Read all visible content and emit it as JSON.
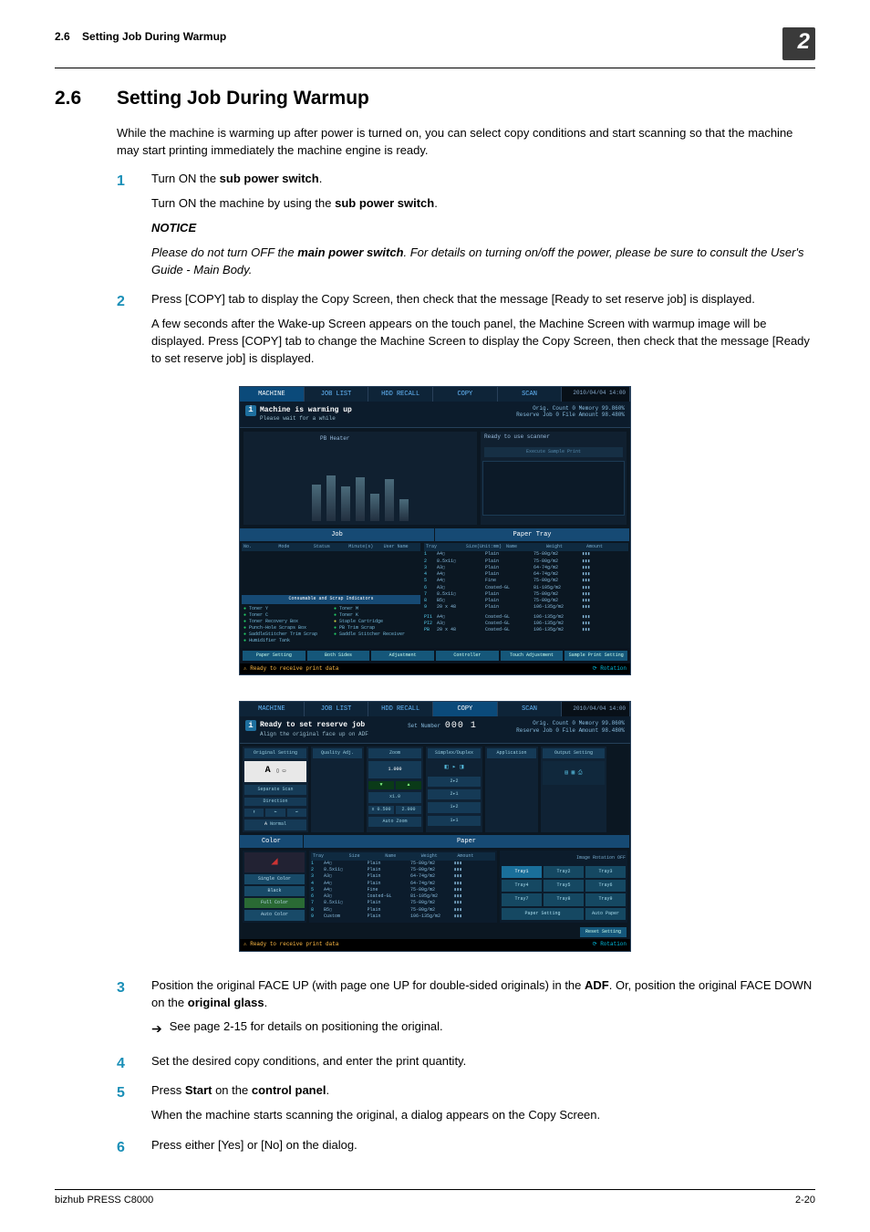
{
  "header": {
    "section_ref": "2.6",
    "section_ref_title": "Setting Job During Warmup",
    "chapter_badge": "2"
  },
  "section": {
    "number": "2.6",
    "title": "Setting Job During Warmup",
    "intro": "While the machine is warming up after power is turned on, you can select copy conditions and start scanning so that the machine may start printing immediately the machine engine is ready."
  },
  "steps": {
    "s1": {
      "num": "1",
      "l1a": "Turn ON the ",
      "l1b": "sub power switch",
      "l1c": ".",
      "l2a": "Turn ON the machine by using the ",
      "l2b": "sub power switch",
      "l2c": ".",
      "notice": "NOTICE",
      "notice_text_a": "Please do not turn OFF the ",
      "notice_text_b": "main power switch",
      "notice_text_c": ". For details on turning on/off the power, please be sure to consult the User's Guide - Main Body."
    },
    "s2": {
      "num": "2",
      "p1": "Press [COPY] tab to display the Copy Screen, then check that the message [Ready to set reserve job] is displayed.",
      "p2": "A few seconds after the Wake-up Screen appears on the touch panel, the Machine Screen with warmup image will be displayed. Press [COPY] tab to change the Machine Screen to display the Copy Screen, then check that the message [Ready to set reserve job] is displayed."
    },
    "s3": {
      "num": "3",
      "p1a": "Position the original FACE UP (with page one UP for double-sided originals) in the ",
      "p1b": "ADF",
      "p1c": ". Or, position the original FACE DOWN on the ",
      "p1d": "original glass",
      "p1e": ".",
      "bullet": "See page 2-15 for details on positioning the original."
    },
    "s4": {
      "num": "4",
      "p1": "Set the desired copy conditions, and enter the print quantity."
    },
    "s5": {
      "num": "5",
      "p1a": "Press ",
      "p1b": "Start",
      "p1c": " on the ",
      "p1d": "control panel",
      "p1e": ".",
      "p2": "When the machine starts scanning the original, a dialog appears on the Copy Screen."
    },
    "s6": {
      "num": "6",
      "p1": "Press either [Yes] or [No] on the dialog."
    }
  },
  "screen1": {
    "tabs": [
      "MACHINE",
      "JOB LIST",
      "HDD RECALL",
      "COPY",
      "SCAN"
    ],
    "datetime": "2010/04/04 14:00",
    "msg_title": "Machine is warming up",
    "msg_sub": "Please wait for a while",
    "counters": {
      "a": "Orig. Count    0   Memory    99.860%",
      "b": "Reserve Job    0   File Amount  98.480%"
    },
    "pb_heater": "PB Heater",
    "ready_scanner": "Ready to use scanner",
    "exec_sample": "Execute Sample Print",
    "job_label": "Job",
    "paper_tray_label": "Paper Tray",
    "job_header": [
      "No.",
      "Mode",
      "Status",
      "Minute(s)",
      "User Name"
    ],
    "paper_header": [
      "Tray",
      "Size(Unit:mm)",
      "Name",
      "Weight",
      "Amount"
    ],
    "trays": [
      [
        "1",
        "A4▢",
        "Plain",
        "75-80g/m2"
      ],
      [
        "2",
        "8.5x11▢",
        "Plain",
        "75-80g/m2"
      ],
      [
        "3",
        "A3▢",
        "Plain",
        "64-74g/m2"
      ],
      [
        "4",
        "A4▢",
        "Plain",
        "64-74g/m2"
      ],
      [
        "5",
        "A4▢",
        "Fine",
        "75-80g/m2"
      ],
      [
        "6",
        "A3▢",
        "Coated-GL",
        "81-105g/m2"
      ],
      [
        "7",
        "8.5x11▢",
        "Plain",
        "75-80g/m2"
      ],
      [
        "8",
        "B5▢",
        "Plain",
        "75-80g/m2"
      ],
      [
        "9",
        "20 x 48",
        "Plain",
        "106-135g/m2"
      ]
    ],
    "pi_trays": [
      [
        "PI1",
        "A4▢",
        "Coated-GL",
        "106-135g/m2"
      ],
      [
        "PI2",
        "A3▢",
        "Coated-GL",
        "106-135g/m2"
      ],
      [
        "PB",
        "20 x 48",
        "Coated-GL",
        "106-135g/m2"
      ]
    ],
    "consum_label": "Consumable and Scrap Indicators",
    "consumables": [
      "Toner Y",
      "Toner M",
      "Toner C",
      "Toner K",
      "Toner Recovery Box",
      "Staple Cartridge",
      "Punch-Hole Scraps Box",
      "PB Trim Scrap",
      "SaddleStitcher Trim Scrap",
      "Saddle Stitcher Receiver",
      "Humidifier Tank"
    ],
    "bottom_buttons": [
      "Paper Setting",
      "Both Sides",
      "Adjustment",
      "Controller",
      "Touch Adjustment",
      "Sample Print Setting"
    ],
    "status": "Ready to receive print data",
    "rotation": "⟳ Rotation"
  },
  "screen2": {
    "tabs": [
      "MACHINE",
      "JOB LIST",
      "HDD RECALL",
      "COPY",
      "SCAN"
    ],
    "datetime": "2010/04/04 14:00",
    "msg_title": "Ready to set reserve job",
    "msg_sub": "Align the original face up on ADF",
    "set_number_label": "Set Number",
    "set_number": "000 1",
    "counters": {
      "a": "Orig. Count    0   Memory    99.860%",
      "b": "Reserve Job    0   File Amount  98.480%"
    },
    "col_headers": [
      "Original Setting",
      "Quality Adj.",
      "Zoom",
      "Simplex/Duplex",
      "Application",
      "Output Setting"
    ],
    "orig_letter": "A",
    "zoom_val": "1.000",
    "zoom_chips": [
      "x1.0",
      "x 0.500",
      "2.000",
      "Auto Zoom"
    ],
    "duplex_chips": [
      "2▸2",
      "2▸1",
      "1▸2",
      "1▸1"
    ],
    "separate_scan": "Separate Scan",
    "direction": "Direction",
    "normal": "Normal",
    "color_label": "Color",
    "color_buttons": [
      "Single Color",
      "Black",
      "Full Color",
      "Auto Color"
    ],
    "paper_label": "Paper",
    "paper_header": [
      "Tray",
      "Size",
      "Name",
      "Weight",
      "Amount"
    ],
    "paper_rows": [
      [
        "1",
        "A4▢",
        "Plain",
        "75-80g/m2"
      ],
      [
        "2",
        "8.5x11▢",
        "Plain",
        "75-80g/m2"
      ],
      [
        "3",
        "A3▢",
        "Plain",
        "64-74g/m2"
      ],
      [
        "4",
        "A4▢",
        "Plain",
        "64-74g/m2"
      ],
      [
        "5",
        "A4▢",
        "Fine",
        "75-80g/m2"
      ],
      [
        "6",
        "A3▢",
        "Coated-GL",
        "81-105g/m2"
      ],
      [
        "7",
        "8.5x11▢",
        "Plain",
        "75-80g/m2"
      ],
      [
        "8",
        "B5▢",
        "Plain",
        "75-80g/m2"
      ],
      [
        "9",
        "Custom",
        "Plain",
        "106-135g/m2"
      ]
    ],
    "image_rotation": "Image Rotation OFF",
    "tray_buttons": [
      "Tray1",
      "Tray2",
      "Tray3",
      "Tray4",
      "Tray5",
      "Tray6",
      "Tray7",
      "Tray8",
      "Tray9"
    ],
    "paper_setting": "Paper Setting",
    "auto_paper": "Auto Paper",
    "reset_setting": "Reset Setting",
    "status": "Ready to receive print data",
    "rotation": "⟳ Rotation"
  },
  "footer": {
    "left": "bizhub PRESS C8000",
    "right": "2-20"
  }
}
